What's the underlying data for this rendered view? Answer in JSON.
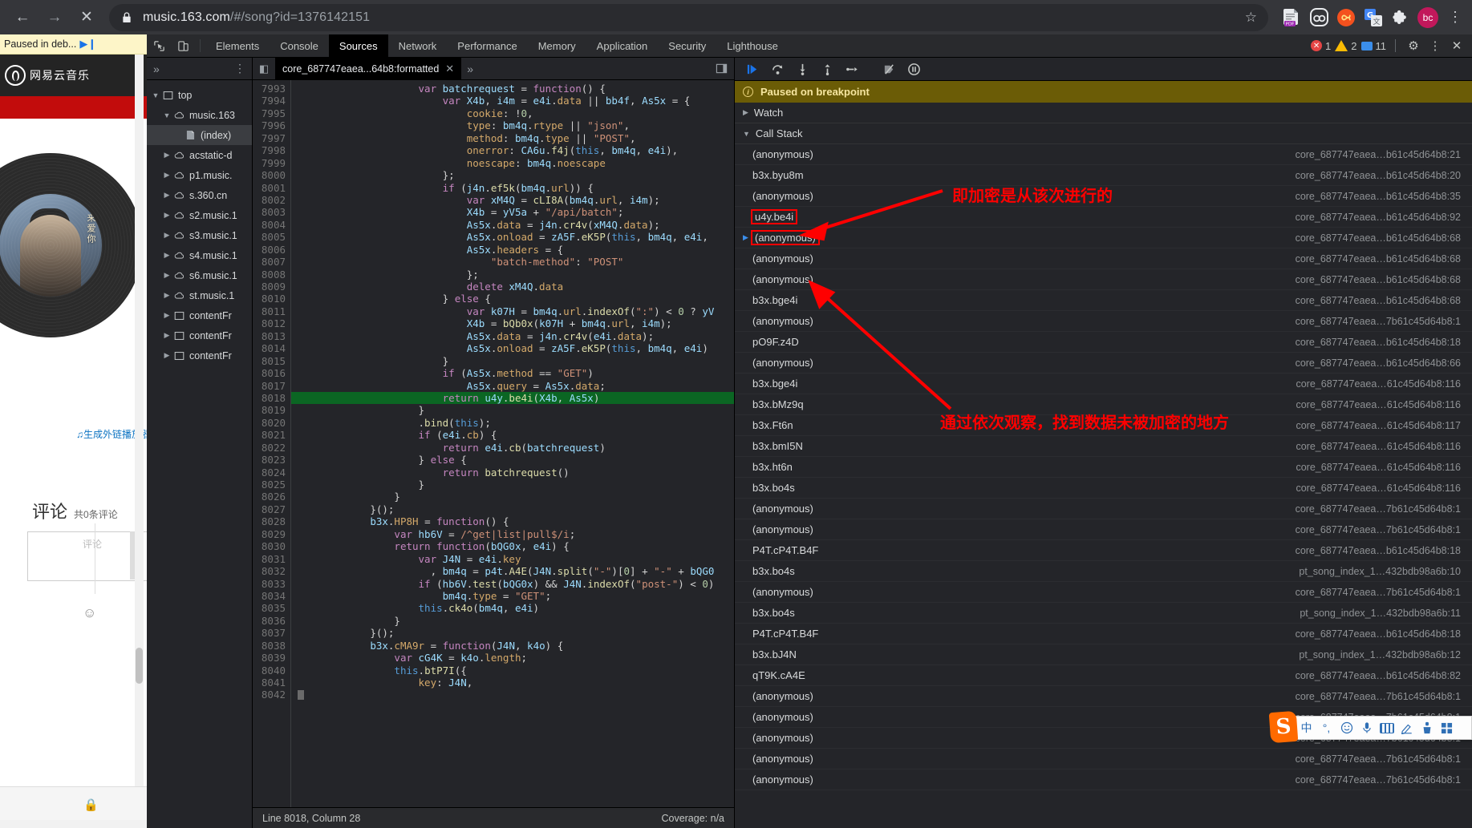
{
  "browser": {
    "back_icon": "←",
    "forward_icon": "→",
    "stop_icon": "✕",
    "lock_icon": "lock-icon",
    "url_secure": "music.163.com",
    "url_path": "/#/song?id=1376142151",
    "star_icon": "☆",
    "extensions": [
      {
        "name": "pdf-extension-icon",
        "label": "PDF"
      },
      {
        "name": "pocket-extension-icon",
        "label": ""
      },
      {
        "name": "infinity-extension-icon",
        "label": "∞"
      },
      {
        "name": "google-translate-icon",
        "label": "G"
      },
      {
        "name": "extensions-puzzle-icon",
        "label": ""
      }
    ],
    "avatar_label": "bc",
    "menu_icon": "⋮"
  },
  "page": {
    "paused_text": "Paused in deb...",
    "resume_icon": "▶❙",
    "site_name": "网易云音乐",
    "generate_link": "♫生成外链播放器",
    "comments_title": "评论",
    "comments_count": "共0条评论",
    "comment_placeholder": "评论",
    "emoji_icon": "☺",
    "lock_icon": "🔒"
  },
  "devtools": {
    "inspect_icon": "inspect-element-icon",
    "device_icon": "device-toolbar-icon",
    "tabs": [
      {
        "label": "Elements",
        "active": false
      },
      {
        "label": "Console",
        "active": false
      },
      {
        "label": "Sources",
        "active": true
      },
      {
        "label": "Network",
        "active": false
      },
      {
        "label": "Performance",
        "active": false
      },
      {
        "label": "Memory",
        "active": false
      },
      {
        "label": "Application",
        "active": false
      },
      {
        "label": "Security",
        "active": false
      },
      {
        "label": "Lighthouse",
        "active": false
      }
    ],
    "counters": {
      "errors": "1",
      "warnings": "2",
      "messages": "11"
    },
    "settings_icon": "⚙",
    "more_icon": "⋮",
    "close_icon": "✕"
  },
  "navigator": {
    "expand_icon": "»",
    "menu_icon": "⋮",
    "tree": [
      {
        "indent": 0,
        "twisty": "▼",
        "icon": "frame-icon",
        "label": "top",
        "selected": false
      },
      {
        "indent": 1,
        "twisty": "▼",
        "icon": "cloud-icon",
        "label": "music.163",
        "selected": false
      },
      {
        "indent": 2,
        "twisty": "",
        "icon": "document-icon",
        "label": "(index)",
        "selected": true
      },
      {
        "indent": 1,
        "twisty": "▶",
        "icon": "cloud-icon",
        "label": "acstatic-d",
        "selected": false
      },
      {
        "indent": 1,
        "twisty": "▶",
        "icon": "cloud-icon",
        "label": "p1.music.",
        "selected": false
      },
      {
        "indent": 1,
        "twisty": "▶",
        "icon": "cloud-icon",
        "label": "s.360.cn",
        "selected": false
      },
      {
        "indent": 1,
        "twisty": "▶",
        "icon": "cloud-icon",
        "label": "s2.music.1",
        "selected": false
      },
      {
        "indent": 1,
        "twisty": "▶",
        "icon": "cloud-icon",
        "label": "s3.music.1",
        "selected": false
      },
      {
        "indent": 1,
        "twisty": "▶",
        "icon": "cloud-icon",
        "label": "s4.music.1",
        "selected": false
      },
      {
        "indent": 1,
        "twisty": "▶",
        "icon": "cloud-icon",
        "label": "s6.music.1",
        "selected": false
      },
      {
        "indent": 1,
        "twisty": "▶",
        "icon": "cloud-icon",
        "label": "st.music.1",
        "selected": false
      },
      {
        "indent": 1,
        "twisty": "▶",
        "icon": "frame-icon",
        "label": "contentFr",
        "selected": false
      },
      {
        "indent": 1,
        "twisty": "▶",
        "icon": "frame-icon",
        "label": "contentFr",
        "selected": false
      },
      {
        "indent": 1,
        "twisty": "▶",
        "icon": "frame-icon",
        "label": "contentFr",
        "selected": false
      }
    ]
  },
  "editor": {
    "tab_label": "core_687747eaea...64b8:formatted",
    "tab_close_icon": "✕",
    "more_tabs_icon": "»",
    "sidebar_toggle_icon": "◧",
    "status_left": "Line 8018, Column 28",
    "status_right": "Coverage: n/a",
    "first_line_number": 7993,
    "exec_line": 8018,
    "lines": [
      "                    var batchrequest = function() {",
      "                        var X4b, i4m = e4i.data || bb4f, As5x = {",
      "                            cookie: !0,",
      "                            type: bm4q.rtype || \"json\",",
      "                            method: bm4q.type || \"POST\",",
      "                            onerror: CA6u.f4j(this, bm4q, e4i),",
      "                            noescape: bm4q.noescape",
      "                        };",
      "                        if (j4n.ef5k(bm4q.url)) {",
      "                            var xM4Q = cLI8A(bm4q.url, i4m);",
      "                            X4b = yV5a + \"/api/batch\";",
      "                            As5x.data = j4n.cr4v(xM4Q.data);",
      "                            As5x.onload = zA5F.eK5P(this, bm4q, e4i, ",
      "                            As5x.headers = {",
      "                                \"batch-method\": \"POST\"",
      "                            };",
      "                            delete xM4Q.data",
      "                        } else {",
      "                            var k07H = bm4q.url.indexOf(\":\") < 0 ? yV",
      "                            X4b = bQb0x(k07H + bm4q.url, i4m);",
      "                            As5x.data = j4n.cr4v(e4i.data);",
      "                            As5x.onload = zA5F.eK5P(this, bm4q, e4i)",
      "                        }",
      "                        if (As5x.method == \"GET\")",
      "                            As5x.query = As5x.data;",
      "                        return u4y.be4i(X4b, As5x)",
      "                    }",
      "                    .bind(this);",
      "                    if (e4i.cb) {",
      "                        return e4i.cb(batchrequest)",
      "                    } else {",
      "                        return batchrequest()",
      "                    }",
      "                }",
      "            }();",
      "            b3x.HP8H = function() {",
      "                var hb6V = /^get|list|pull$/i;",
      "                return function(bQG0x, e4i) {",
      "                    var J4N = e4i.key",
      "                      , bm4q = p4t.A4E(J4N.split(\"-\")[0] + \"-\" + bQG0",
      "                    if (hb6V.test(bQG0x) && J4N.indexOf(\"post-\") < 0)",
      "                        bm4q.type = \"GET\";",
      "                    this.ck4o(bm4q, e4i)",
      "                }",
      "            }();",
      "            b3x.cMA9r = function(J4N, k4o) {",
      "                var cG4K = k4o.length;",
      "                this.btP7I({",
      "                    key: J4N,",
      ""
    ]
  },
  "debugger": {
    "toolbar": [
      {
        "name": "resume-button",
        "icon": "▶"
      },
      {
        "name": "step-over-button",
        "icon": "↷"
      },
      {
        "name": "step-into-button",
        "icon": "↓"
      },
      {
        "name": "step-out-button",
        "icon": "↑"
      },
      {
        "name": "step-button",
        "icon": "→"
      },
      {
        "name": "deactivate-breakpoints-button",
        "icon": "⦸"
      },
      {
        "name": "pause-on-exceptions-button",
        "icon": "❙❙"
      }
    ],
    "paused_banner": "Paused on breakpoint",
    "info_icon": "i",
    "sections": [
      {
        "label": "Watch",
        "expanded": false,
        "caret": "▶"
      },
      {
        "label": "Call Stack",
        "expanded": true,
        "caret": "▼"
      }
    ],
    "call_stack": [
      {
        "name": "(anonymous)",
        "location": "core_687747eaea…b61c45d64b8:21",
        "current": false,
        "boxed": false
      },
      {
        "name": "b3x.byu8m",
        "location": "core_687747eaea…b61c45d64b8:20",
        "current": false,
        "boxed": false
      },
      {
        "name": "(anonymous)",
        "location": "core_687747eaea…b61c45d64b8:35",
        "current": false,
        "boxed": false
      },
      {
        "name": "u4y.be4i",
        "location": "core_687747eaea…b61c45d64b8:92",
        "current": false,
        "boxed": true
      },
      {
        "name": "(anonymous)",
        "location": "core_687747eaea…b61c45d64b8:68",
        "current": true,
        "boxed": true
      },
      {
        "name": "(anonymous)",
        "location": "core_687747eaea…b61c45d64b8:68",
        "current": false,
        "boxed": false
      },
      {
        "name": "(anonymous)",
        "location": "core_687747eaea…b61c45d64b8:68",
        "current": false,
        "boxed": false
      },
      {
        "name": "b3x.bge4i",
        "location": "core_687747eaea…b61c45d64b8:68",
        "current": false,
        "boxed": false
      },
      {
        "name": "(anonymous)",
        "location": "core_687747eaea…7b61c45d64b8:1",
        "current": false,
        "boxed": false
      },
      {
        "name": "pO9F.z4D",
        "location": "core_687747eaea…b61c45d64b8:18",
        "current": false,
        "boxed": false
      },
      {
        "name": "(anonymous)",
        "location": "core_687747eaea…b61c45d64b8:66",
        "current": false,
        "boxed": false
      },
      {
        "name": "b3x.bge4i",
        "location": "core_687747eaea…61c45d64b8:116",
        "current": false,
        "boxed": false
      },
      {
        "name": "b3x.bMz9q",
        "location": "core_687747eaea…61c45d64b8:116",
        "current": false,
        "boxed": false
      },
      {
        "name": "b3x.Ft6n",
        "location": "core_687747eaea…61c45d64b8:117",
        "current": false,
        "boxed": false
      },
      {
        "name": "b3x.bmI5N",
        "location": "core_687747eaea…61c45d64b8:116",
        "current": false,
        "boxed": false
      },
      {
        "name": "b3x.ht6n",
        "location": "core_687747eaea…61c45d64b8:116",
        "current": false,
        "boxed": false
      },
      {
        "name": "b3x.bo4s",
        "location": "core_687747eaea…61c45d64b8:116",
        "current": false,
        "boxed": false
      },
      {
        "name": "(anonymous)",
        "location": "core_687747eaea…7b61c45d64b8:1",
        "current": false,
        "boxed": false
      },
      {
        "name": "(anonymous)",
        "location": "core_687747eaea…7b61c45d64b8:1",
        "current": false,
        "boxed": false
      },
      {
        "name": "P4T.cP4T.B4F",
        "location": "core_687747eaea…b61c45d64b8:18",
        "current": false,
        "boxed": false
      },
      {
        "name": "b3x.bo4s",
        "location": "pt_song_index_1…432bdb98a6b:10",
        "current": false,
        "boxed": false
      },
      {
        "name": "(anonymous)",
        "location": "core_687747eaea…7b61c45d64b8:1",
        "current": false,
        "boxed": false
      },
      {
        "name": "b3x.bo4s",
        "location": "pt_song_index_1…432bdb98a6b:11",
        "current": false,
        "boxed": false
      },
      {
        "name": "P4T.cP4T.B4F",
        "location": "core_687747eaea…b61c45d64b8:18",
        "current": false,
        "boxed": false
      },
      {
        "name": "b3x.bJ4N",
        "location": "pt_song_index_1…432bdb98a6b:12",
        "current": false,
        "boxed": false
      },
      {
        "name": "qT9K.cA4E",
        "location": "core_687747eaea…b61c45d64b8:82",
        "current": false,
        "boxed": false
      },
      {
        "name": "(anonymous)",
        "location": "core_687747eaea…7b61c45d64b8:1",
        "current": false,
        "boxed": false
      },
      {
        "name": "(anonymous)",
        "location": "core_687747eaea…7b61c45d64b8:1",
        "current": false,
        "boxed": false
      },
      {
        "name": "(anonymous)",
        "location": "core_687747eaea…7b61c45d64b8:1",
        "current": false,
        "boxed": false
      },
      {
        "name": "(anonymous)",
        "location": "core_687747eaea…7b61c45d64b8:1",
        "current": false,
        "boxed": false
      },
      {
        "name": "(anonymous)",
        "location": "core_687747eaea…7b61c45d64b8:1",
        "current": false,
        "boxed": false
      }
    ]
  },
  "annotations": {
    "accent_color": "#ff0000",
    "note_top": "即加密是从该次进行的",
    "note_bottom": "通过依次观察，找到数据未被加密的地方"
  },
  "ime": {
    "logo_letter": "S",
    "items": [
      {
        "name": "ime-mode-chinese",
        "glyph": "中"
      },
      {
        "name": "ime-punctuation",
        "glyph": "°,"
      },
      {
        "name": "ime-emoji",
        "glyph": "☺"
      },
      {
        "name": "ime-voice-input",
        "glyph": "🎤"
      },
      {
        "name": "ime-soft-keyboard",
        "glyph": "keyboard"
      },
      {
        "name": "ime-handwriting",
        "glyph": "✍"
      },
      {
        "name": "ime-toolbox",
        "glyph": "🧰"
      },
      {
        "name": "ime-apps",
        "glyph": "▦"
      }
    ]
  }
}
